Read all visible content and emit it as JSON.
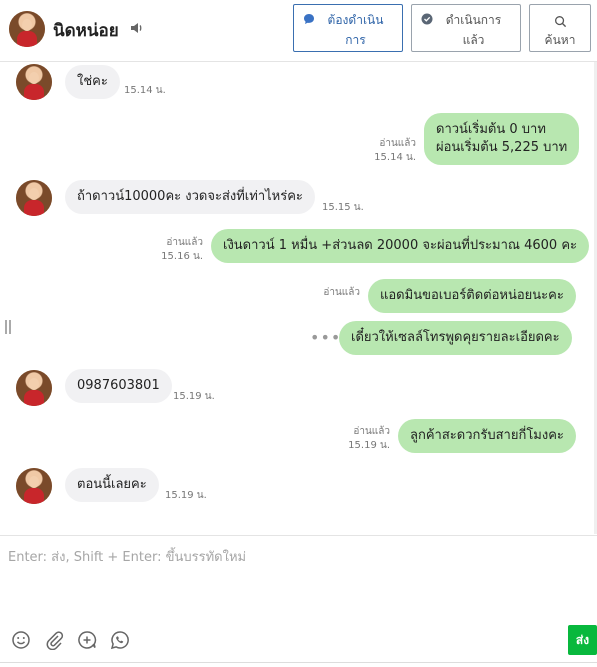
{
  "header": {
    "contact_name": "นิดหน่อย",
    "btn_pending": "ต้องดำเนินการ",
    "btn_done": "ดำเนินการแล้ว",
    "btn_search": "ค้นหา"
  },
  "messages": [
    {
      "dir": "in",
      "text": "ใช่คะ",
      "time": "15.14 น."
    },
    {
      "dir": "out",
      "line1": "ดาวน์เริ่มต้น 0 บาท",
      "line2": "ผ่อนเริ่มต้น 5,225 บาท",
      "read": "อ่านแล้ว",
      "time": "15.14 น."
    },
    {
      "dir": "in",
      "text": "ถ้าดาวน์10000คะ งวดจะส่งที่เท่าไหร่คะ",
      "time": "15.15 น."
    },
    {
      "dir": "out",
      "text": "เงินดาวน์ 1 หมื่น +ส่วนลด 20000 จะผ่อนที่ประมาณ 4600 คะ",
      "read": "อ่านแล้ว",
      "time": "15.16 น."
    },
    {
      "dir": "out",
      "text": "แอดมินขอเบอร์ติดต่อหน่อยนะคะ",
      "read": "อ่านแล้ว"
    },
    {
      "dir": "out",
      "text": "เดี๋ยวให้เซลล์โทรพูดคุยรายละเอียดคะ",
      "dots": "•••"
    },
    {
      "dir": "in",
      "text": "0987603801",
      "time": "15.19 น."
    },
    {
      "dir": "out",
      "text": "ลูกค้าสะดวกรับสายกี่โมงคะ",
      "read": "อ่านแล้ว",
      "time": "15.19 น."
    },
    {
      "dir": "in",
      "text": "ตอนนี้เลยคะ",
      "time": "15.19 น."
    }
  ],
  "composer": {
    "placeholder": "Enter: ส่ง, Shift + Enter: ขึ้นบรรทัดใหม่",
    "send_label": "ส่ง"
  },
  "colors": {
    "outgoing_bubble": "#b8e7b0",
    "incoming_bubble": "#f1f1f3",
    "send_button": "#08b83d",
    "primary_button": "#2f64a8"
  },
  "icons": [
    "speaker-icon",
    "chat-bubble-icon",
    "check-circle-icon",
    "search-icon",
    "emoji-icon",
    "attachment-icon",
    "add-circle-icon",
    "whatsapp-icon"
  ]
}
